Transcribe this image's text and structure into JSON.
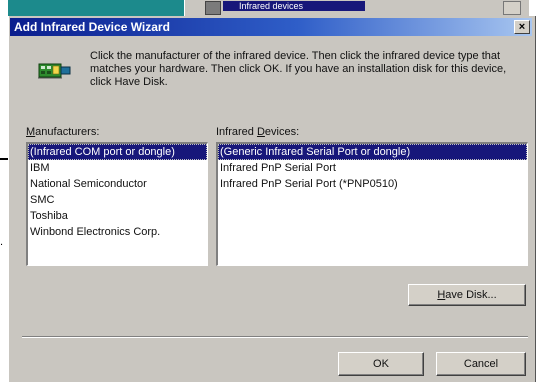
{
  "background": {
    "selected_item": "Infrared devices"
  },
  "dialog": {
    "title": "Add Infrared Device Wizard",
    "close_glyph": "×",
    "instructions": "Click the manufacturer of the infrared device. Then click the infrared device type that matches your hardware. Then click OK. If you have an installation disk for this device, click Have Disk.",
    "manufacturers_label_prefix": "M",
    "manufacturers_label_rest": "anufacturers:",
    "devices_label_prefix": "Infrared ",
    "devices_label_ul": "D",
    "devices_label_rest": "evices:",
    "manufacturers": [
      "(Infrared COM port or dongle)",
      "IBM",
      "National Semiconductor",
      "SMC",
      "Toshiba",
      "Winbond Electronics Corp."
    ],
    "devices": [
      "(Generic Infrared Serial Port or dongle)",
      "Infrared PnP Serial Port",
      "Infrared PnP Serial Port (*PNP0510)"
    ],
    "selected_manufacturer": "(Infrared COM port or dongle)",
    "selected_device": "(Generic Infrared Serial Port or dongle)",
    "have_disk_ul": "H",
    "have_disk_rest": "ave Disk...",
    "ok_label": "OK",
    "cancel_label": "Cancel"
  },
  "page_edge": {
    "dot": "."
  },
  "colors": {
    "title_gradient_start": "#0b1e8e",
    "title_gradient_end": "#a8c6f0",
    "selection": "#17177a",
    "face": "#c9c6c0",
    "desktop": "#1c8a8c"
  }
}
